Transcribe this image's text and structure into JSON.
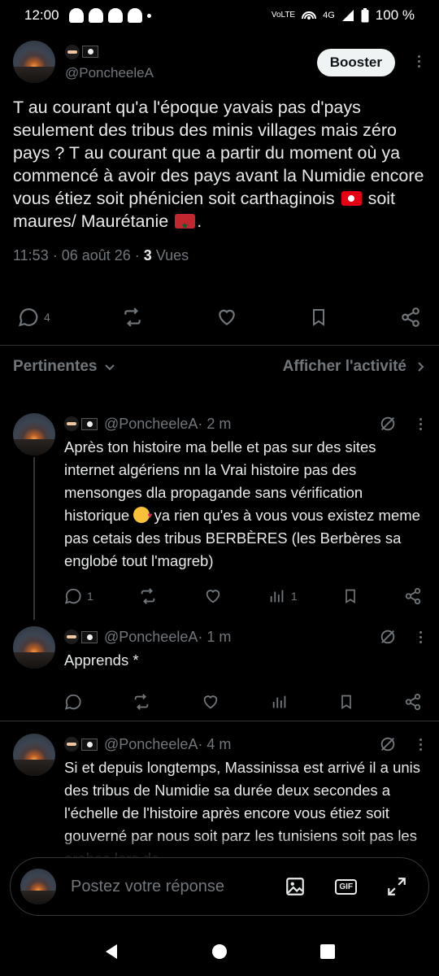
{
  "status_bar": {
    "time": "12:00",
    "network": "VoLTE",
    "signal": "4G",
    "battery": "100 %"
  },
  "main_tweet": {
    "handle": "@PoncheeleA",
    "booster_label": "Booster",
    "text_parts": [
      "T au courant qu'a l'époque yavais pas d'pays seulement des tribus des minis villages mais zéro pays ? T au courant que a partir du moment où ya commencé à avoir des pays avant la Numidie encore vous étiez soit phénicien soit carthaginois",
      "soit maures/ Maurétanie",
      "."
    ],
    "timestamp": "11:53 · 06 août 26 · ",
    "views_count": "3",
    "views_label": " Vues",
    "reply_count": "4"
  },
  "filter": {
    "left_label": "Pertinentes",
    "right_label": "Afficher l'activité"
  },
  "replies": [
    {
      "handle": "@PoncheeleA",
      "time": " · 2 m",
      "text_a": "Après ton histoire ma belle et pas sur des sites internet algériens nn la Vrai histoire pas des mensonges dla propagande sans vérification historique",
      "text_b": " ya rien qu'es à vous vous existez meme pas cetais des tribus BERBÈRES (les Berbères sa englobé tout l'magreb)",
      "reply_count": "1",
      "views_count": "1"
    },
    {
      "handle": "@PoncheeleA",
      "time": " · 1 m",
      "text_a": "Apprends *",
      "text_b": ""
    },
    {
      "handle": "@PoncheeleA",
      "time": " · 4 m",
      "text_a": "Si et depuis longtemps, Massinissa est arrivé il a unis des tribus de Numidie sa durée deux secondes a l'échelle de l'histoire après encore vous étiez soit gouverné par nous soit parz les tunisiens soit pas les arabes lors de",
      "text_b": ""
    }
  ],
  "composer": {
    "placeholder": "Postez votre réponse",
    "gif_label": "GIF"
  }
}
